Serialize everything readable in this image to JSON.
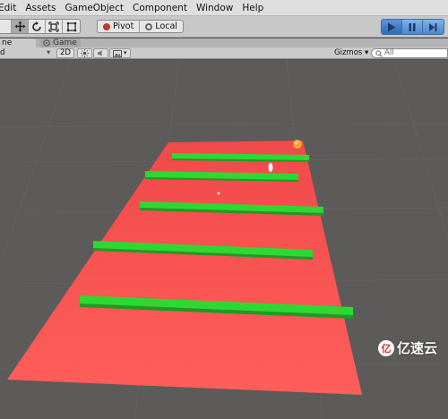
{
  "menu": {
    "items": [
      "Edit",
      "Assets",
      "GameObject",
      "Component",
      "Window",
      "Help"
    ]
  },
  "toolbar": {
    "transform_tools": [
      "move-icon",
      "rotate-icon",
      "scale-icon",
      "rect-icon"
    ],
    "pivot_label": "Pivot",
    "local_label": "Local",
    "play_controls": [
      "play-icon",
      "pause-icon",
      "step-icon"
    ],
    "play_active": true
  },
  "tabs": {
    "scene_label": "ne",
    "game_label": "Game"
  },
  "scene_bar": {
    "shading_label": "d",
    "mode_2d_label": "2D",
    "gizmos_label": "Gizmos",
    "search_placeholder": "All"
  },
  "watermark": {
    "text": "亿速云"
  },
  "colors": {
    "plane": "#f25454",
    "bars": "#2ed832",
    "ball": "#f0a830",
    "background": "#5d5b59",
    "play_accent": "#4e86cc"
  }
}
